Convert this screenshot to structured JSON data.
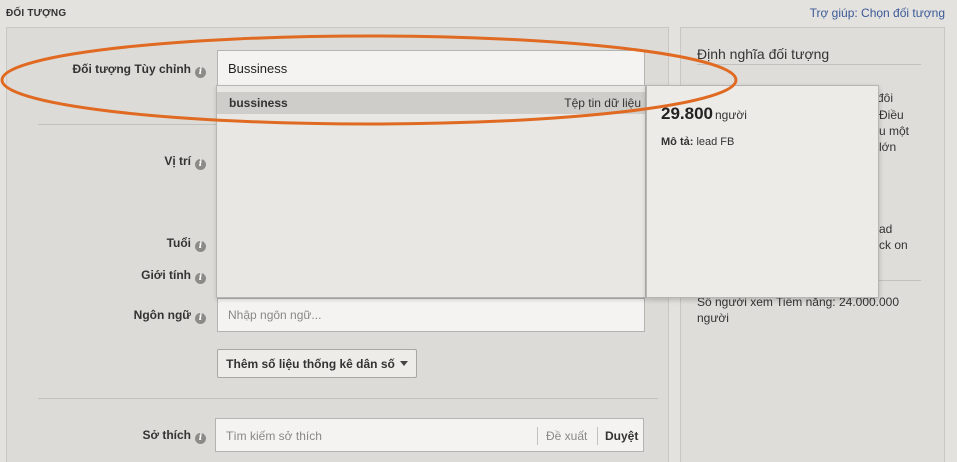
{
  "header": {
    "section_title": "ĐỐI TƯỢNG",
    "help_link": "Trợ giúp: Chọn đối tượng"
  },
  "form": {
    "custom_audience_label": "Đối tượng Tùy chỉnh",
    "custom_audience_value": "Bussiness",
    "location_label": "Vị trí",
    "age_label": "Tuổi",
    "gender_label": "Giới tính",
    "language_label": "Ngôn ngữ",
    "language_placeholder": "Nhập ngôn ngữ...",
    "demographics_button": "Thêm số liệu thống kê dân số",
    "interests_label": "Sở thích",
    "interests_placeholder": "Tìm kiếm sở thích",
    "interests_suggest": "Đề xuất",
    "interests_browse": "Duyệt"
  },
  "dropdown": {
    "items": [
      {
        "name": "bussiness",
        "type": "Tệp tin dữ liệu"
      }
    ]
  },
  "tooltip": {
    "count": "29.800",
    "unit": "người",
    "desc_label": "Mô tả:",
    "desc_value": "lead FB"
  },
  "right_panel": {
    "title": "Định nghĩa đối tượng",
    "fragments": [
      "đôi",
      "Điều",
      "u một",
      "lớn",
      "ad",
      "ck on"
    ],
    "reach_text": "Số người xem Tiềm năng: 24.000.000 người"
  },
  "colors": {
    "annotation": "#e06a22",
    "link": "#3b5998"
  }
}
